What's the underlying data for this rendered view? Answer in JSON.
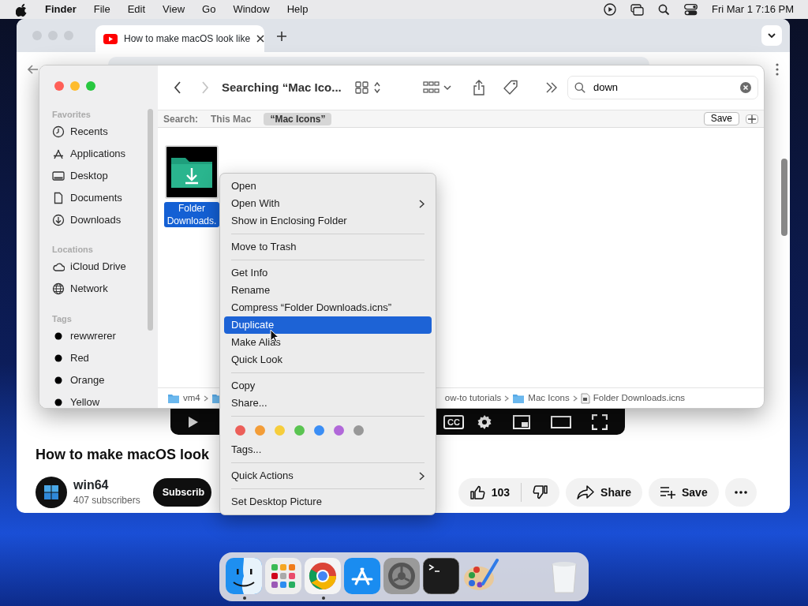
{
  "menubar": {
    "app": "Finder",
    "menus": [
      "File",
      "Edit",
      "View",
      "Go",
      "Window",
      "Help"
    ],
    "clock": "Fri Mar 1  7:16 PM"
  },
  "browser": {
    "tab_title": "How to make macOS look like",
    "video_player": {
      "caption_label": "CC"
    },
    "video_title": "How to make macOS look",
    "channel": {
      "name": "win64",
      "subscribers": "407 subscribers",
      "subscribe": "Subscrib"
    },
    "actions": {
      "likes": "103",
      "share": "Share",
      "save": "Save"
    }
  },
  "finder": {
    "nav": {
      "back_enabled": true,
      "forward_enabled": false
    },
    "title": "Searching “Mac Ico...",
    "search_value": "down",
    "scope_label": "Search:",
    "scopes": [
      {
        "label": "This Mac",
        "selected": false
      },
      {
        "label": "“Mac Icons”",
        "selected": true
      }
    ],
    "save_button": "Save",
    "sidebar": [
      {
        "heading": "Favorites",
        "items": [
          {
            "kind": "clock",
            "label": "Recents"
          },
          {
            "kind": "apps",
            "label": "Applications"
          },
          {
            "kind": "desktop",
            "label": "Desktop"
          },
          {
            "kind": "document",
            "label": "Documents"
          },
          {
            "kind": "download",
            "label": "Downloads"
          }
        ]
      },
      {
        "heading": "Locations",
        "items": [
          {
            "kind": "cloud",
            "label": "iCloud Drive"
          },
          {
            "kind": "globe",
            "label": "Network"
          }
        ]
      },
      {
        "heading": "Tags",
        "items": [
          {
            "kind": "tag",
            "label": "rewwrerer"
          },
          {
            "kind": "tag",
            "label": "Red"
          },
          {
            "kind": "tag",
            "label": "Orange"
          },
          {
            "kind": "tag",
            "label": "Yellow"
          }
        ]
      }
    ],
    "files": [
      {
        "name": "Folder Downloads.",
        "selected": true
      }
    ],
    "path": [
      {
        "kind": "folder",
        "label": "vm4"
      },
      {
        "kind": "folder"
      },
      {
        "kind": "partial",
        "label": "ow-to tutorials"
      },
      {
        "kind": "folder",
        "label": "Mac Icons"
      },
      {
        "kind": "file",
        "label": "Folder Downloads.icns"
      }
    ]
  },
  "context_menu": {
    "sections": [
      {
        "kind": "items",
        "items": [
          {
            "label": "Open",
            "selected": false,
            "submenu": false
          },
          {
            "label": "Open With",
            "selected": false,
            "submenu": true
          },
          {
            "label": "Show in Enclosing Folder",
            "selected": false,
            "submenu": false
          }
        ]
      },
      {
        "kind": "items",
        "items": [
          {
            "label": "Move to Trash",
            "selected": false,
            "submenu": false
          }
        ]
      },
      {
        "kind": "items",
        "items": [
          {
            "label": "Get Info",
            "selected": false,
            "submenu": false
          },
          {
            "label": "Rename",
            "selected": false,
            "submenu": false
          },
          {
            "label": "Compress “Folder Downloads.icns”",
            "selected": false,
            "submenu": false
          },
          {
            "label": "Duplicate",
            "selected": true,
            "submenu": false
          },
          {
            "label": "Make Alias",
            "selected": false,
            "submenu": false
          },
          {
            "label": "Quick Look",
            "selected": false,
            "submenu": false
          }
        ]
      },
      {
        "kind": "items",
        "items": [
          {
            "label": "Copy",
            "selected": false,
            "submenu": false
          },
          {
            "label": "Share...",
            "selected": false,
            "submenu": false
          }
        ]
      },
      {
        "kind": "colors",
        "colors": [
          {
            "color": "#ec5f59"
          },
          {
            "color": "#f39d38"
          },
          {
            "color": "#f6cd3c"
          },
          {
            "color": "#5ac451"
          },
          {
            "color": "#3b8ef5"
          },
          {
            "color": "#b168d9"
          },
          {
            "color": "#989898"
          }
        ],
        "items": [
          {
            "label": "Tags...",
            "selected": false,
            "submenu": false
          }
        ]
      },
      {
        "kind": "items",
        "items": [
          {
            "label": "Quick Actions",
            "selected": false,
            "submenu": true
          }
        ]
      },
      {
        "kind": "items",
        "items": [
          {
            "label": "Set Desktop Picture",
            "selected": false,
            "submenu": false
          }
        ]
      }
    ]
  },
  "dock": [
    {
      "kind": "finder",
      "running": true
    },
    {
      "kind": "launchpad",
      "running": false
    },
    {
      "kind": "chrome",
      "running": true
    },
    {
      "kind": "appstore",
      "running": false
    },
    {
      "kind": "settings",
      "running": false
    },
    {
      "kind": "terminal",
      "running": false
    },
    {
      "kind": "paint",
      "running": false
    },
    {
      "kind": "trash",
      "running": false
    }
  ]
}
